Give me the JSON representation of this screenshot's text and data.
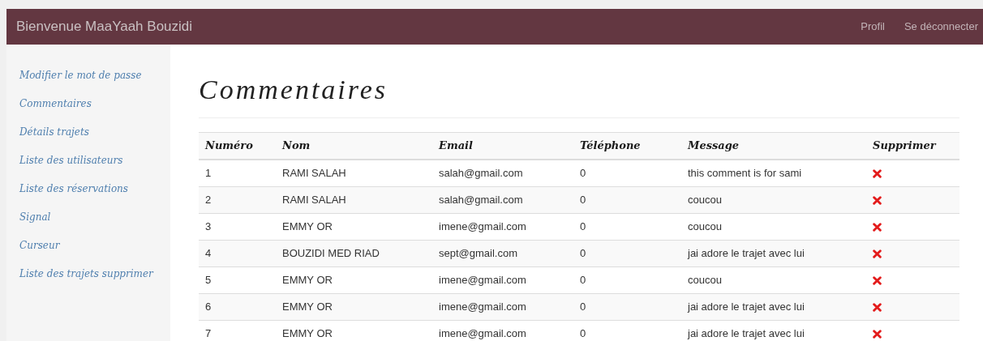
{
  "navbar": {
    "brand": "Bienvenue MaaYaah Bouzidi",
    "links": [
      "Profil",
      "Se déconnecter"
    ]
  },
  "sidebar": {
    "items": [
      "Modifier le mot de passe",
      "Commentaires",
      "Détails trajets",
      "Liste des utilisateurs",
      "Liste des réservations",
      "Signal",
      "Curseur",
      "Liste des trajets supprimer"
    ]
  },
  "page_title": "Commentaires",
  "table": {
    "columns": [
      "Numéro",
      "Nom",
      "Email",
      "Téléphone",
      "Message",
      "Supprimer"
    ],
    "rows": [
      {
        "numero": "1",
        "nom": "RAMI SALAH",
        "email": "salah@gmail.com",
        "telephone": "0",
        "message": "this comment is for sami"
      },
      {
        "numero": "2",
        "nom": "RAMI SALAH",
        "email": "salah@gmail.com",
        "telephone": "0",
        "message": "coucou"
      },
      {
        "numero": "3",
        "nom": "EMMY OR",
        "email": "imene@gmail.com",
        "telephone": "0",
        "message": "coucou"
      },
      {
        "numero": "4",
        "nom": "BOUZIDI MED RIAD",
        "email": "sept@gmail.com",
        "telephone": "0",
        "message": "jai adore le trajet avec lui"
      },
      {
        "numero": "5",
        "nom": "EMMY OR",
        "email": "imene@gmail.com",
        "telephone": "0",
        "message": "coucou"
      },
      {
        "numero": "6",
        "nom": "EMMY OR",
        "email": "imene@gmail.com",
        "telephone": "0",
        "message": "jai adore le trajet avec lui"
      },
      {
        "numero": "7",
        "nom": "EMMY OR",
        "email": "imene@gmail.com",
        "telephone": "0",
        "message": "jai adore le trajet avec lui"
      }
    ]
  }
}
